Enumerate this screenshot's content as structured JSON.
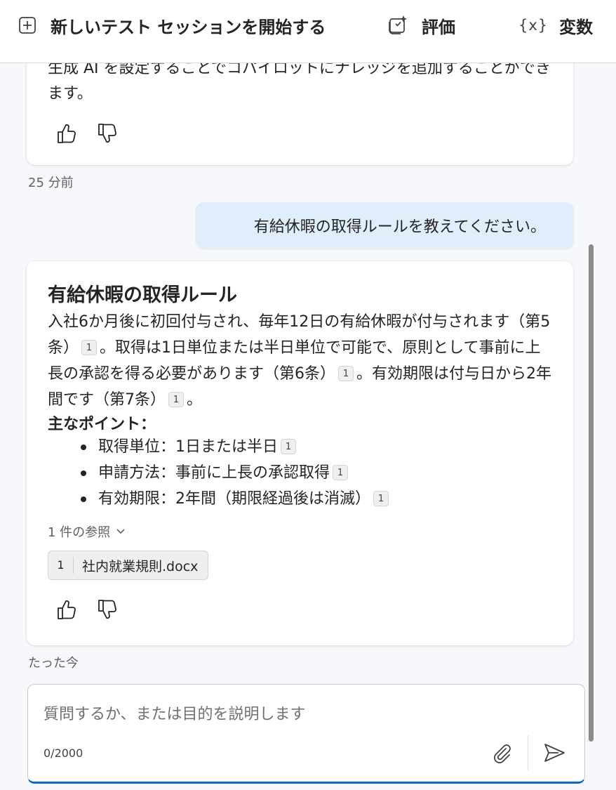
{
  "toolbar": {
    "new_session_label": "新しいテスト セッションを開始する",
    "evaluate_label": "評価",
    "variables_label": "変数",
    "variables_glyph": "{x}"
  },
  "previous_message": {
    "text": "生成 AI を設定することでコパイロットにナレッジを追加することができます。",
    "timestamp": "25 分前"
  },
  "user_message": {
    "text": "有給休暇の取得ルールを教えてください。"
  },
  "response": {
    "title": "有給休暇の取得ルール",
    "p1": "入社6か月後に初回付与され、毎年12日の有給休暇が付与されます（第5条）",
    "p2": "。取得は1日単位または半日単位で可能で、原則として事前に上長の承認を得る必要があります（第6条）",
    "p3": "。有効期限は付与日から2年間です（第7条）",
    "p4": "。",
    "citation": "1",
    "points_heading": "主なポイント：",
    "points": [
      {
        "text": "取得単位：1日または半日",
        "citation": "1"
      },
      {
        "text": "申請方法：事前に上長の承認取得",
        "citation": "1"
      },
      {
        "text": "有効期限：2年間（期限経過後は消滅）",
        "citation": "1"
      }
    ],
    "references_label": "1 件の参照",
    "reference": {
      "number": "1",
      "name": "社内就業規則.docx"
    },
    "timestamp": "たった今"
  },
  "composer": {
    "placeholder": "質問するか、または目的を説明します",
    "counter": "0/2000"
  },
  "colors": {
    "accent": "#0f6cbd",
    "user_bubble": "#e0eefb",
    "background": "#f6f8fb"
  }
}
